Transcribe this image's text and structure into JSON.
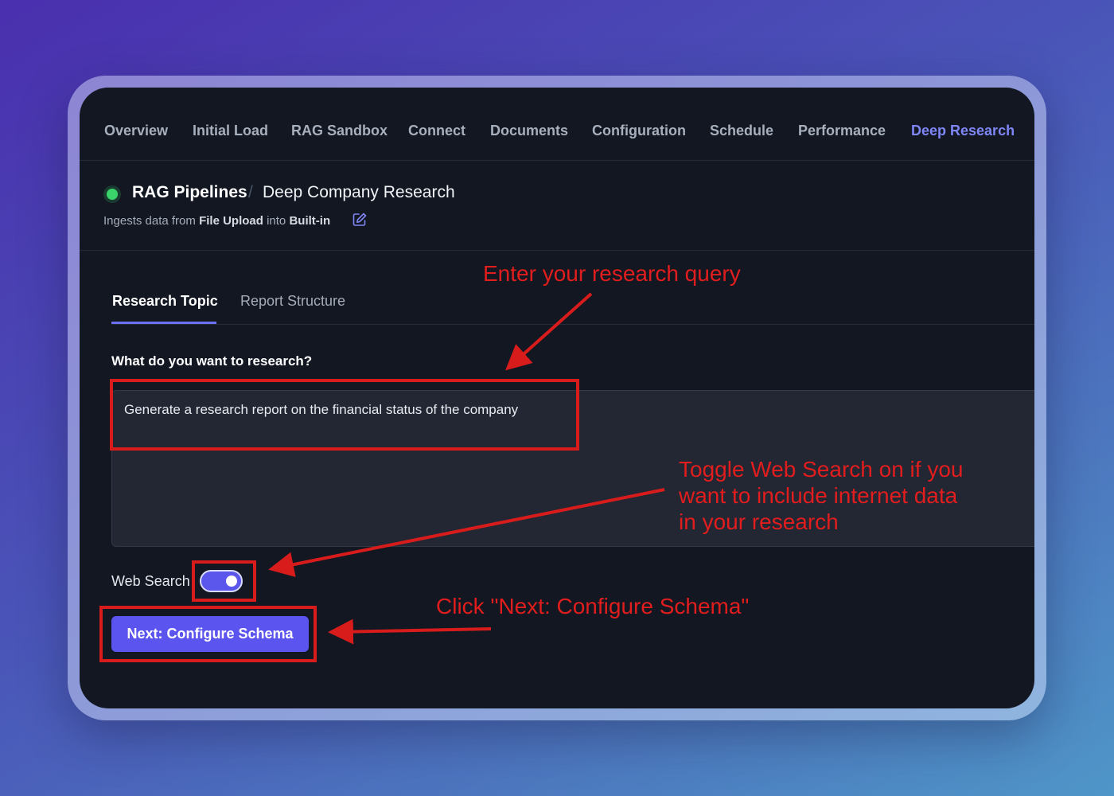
{
  "nav": {
    "items": [
      {
        "label": "Overview",
        "active": false
      },
      {
        "label": "Initial Load",
        "active": false
      },
      {
        "label": "RAG Sandbox",
        "active": false
      },
      {
        "label": "Connect",
        "active": false
      },
      {
        "label": "Documents",
        "active": false
      },
      {
        "label": "Configuration",
        "active": false
      },
      {
        "label": "Schedule",
        "active": false
      },
      {
        "label": "Performance",
        "active": false
      },
      {
        "label": "Deep Research",
        "active": true
      }
    ]
  },
  "header": {
    "breadcrumb_root": "RAG Pipelines",
    "breadcrumb_separator": "/",
    "breadcrumb_current": "Deep Company Research",
    "subtitle_prefix": "Ingests data from",
    "subtitle_source": "File Upload",
    "subtitle_middle": "into",
    "subtitle_target": "Built-in",
    "status": "active"
  },
  "tabs": [
    {
      "label": "Research Topic",
      "active": true
    },
    {
      "label": "Report Structure",
      "active": false
    }
  ],
  "form": {
    "question_label": "What do you want to research?",
    "query_value": "Generate a research report on the financial status of the company",
    "web_search_label": "Web Search",
    "web_search_enabled": true,
    "next_button_label": "Next: Configure Schema"
  },
  "annotations": {
    "query_hint": "Enter your research query",
    "toggle_hint_line1": "Toggle Web Search on if you",
    "toggle_hint_line2": "want to include internet data",
    "toggle_hint_line3": "in your research",
    "button_hint": "Click \"Next: Configure Schema\""
  },
  "colors": {
    "accent": "#5b54ee",
    "active_tab": "#7f86f5",
    "status_green": "#3ad26a",
    "annotation_red": "#d81b1b",
    "window_bg": "#121722"
  }
}
